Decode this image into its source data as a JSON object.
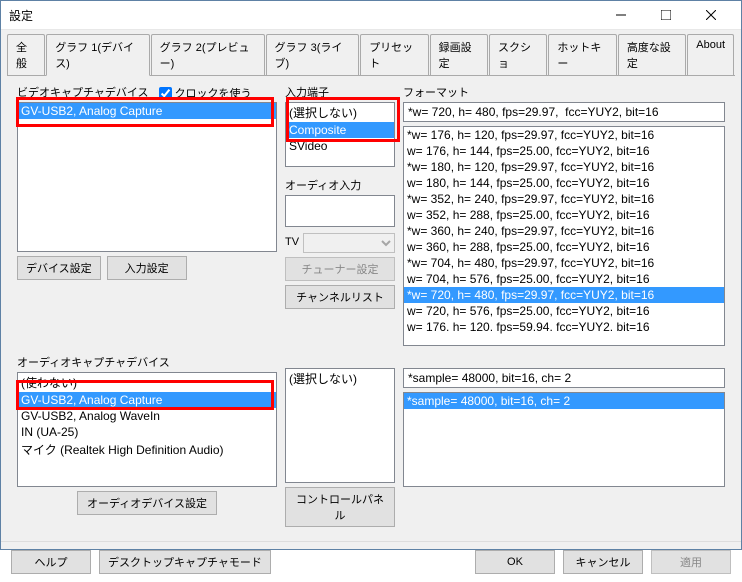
{
  "window_title": "設定",
  "tabs": [
    "全般",
    "グラフ 1(デバイス)",
    "グラフ 2(プレビュー)",
    "グラフ 3(ライブ)",
    "プリセット",
    "録画設定",
    "スクショ",
    "ホットキー",
    "高度な設定",
    "About"
  ],
  "active_tab": 1,
  "labels": {
    "video_device": "ビデオキャプチャデバイス",
    "use_clock": "クロックを使う",
    "device_settings": "デバイス設定",
    "input_settings": "入力設定",
    "audio_device": "オーディオキャプチャデバイス",
    "audio_device_settings": "オーディオデバイス設定",
    "input_terminal": "入力端子",
    "audio_input": "オーディオ入力",
    "tv": "TV",
    "tuner_settings": "チューナー設定",
    "channel_list": "チャンネルリスト",
    "control_panel": "コントロールパネル",
    "format": "フォーマット",
    "not_select": "(選択しない)",
    "help": "ヘルプ",
    "desktop_capture": "デスクトップキャプチャモード",
    "ok": "OK",
    "cancel": "キャンセル",
    "apply": "適用"
  },
  "video_devices": [
    "GV-USB2, Analog Capture"
  ],
  "video_device_selected": 0,
  "input_terminals": [
    "(選択しない)",
    "Composite",
    "SVideo"
  ],
  "input_terminal_selected": 1,
  "audio_devices": [
    "(使わない)",
    "GV-USB2, Analog Capture",
    "GV-USB2, Analog WaveIn",
    "IN (UA-25)",
    "マイク (Realtek High Definition Audio)"
  ],
  "audio_device_selected": 1,
  "format_current": "*w= 720, h= 480, fps=29.97,  fcc=YUY2, bit=16",
  "formats": [
    "*w= 176, h= 120, fps=29.97,  fcc=YUY2, bit=16",
    "w= 176, h= 144, fps=25.00,  fcc=YUY2, bit=16",
    "*w= 180, h= 120, fps=29.97,  fcc=YUY2, bit=16",
    "w= 180, h= 144, fps=25.00,  fcc=YUY2, bit=16",
    "*w= 352, h= 240, fps=29.97,  fcc=YUY2, bit=16",
    "w= 352, h= 288, fps=25.00,  fcc=YUY2, bit=16",
    "*w= 360, h= 240, fps=29.97,  fcc=YUY2, bit=16",
    "w= 360, h= 288, fps=25.00,  fcc=YUY2, bit=16",
    "*w= 704, h= 480, fps=29.97,  fcc=YUY2, bit=16",
    "w= 704, h= 576, fps=25.00,  fcc=YUY2, bit=16",
    "*w= 720, h= 480, fps=29.97,  fcc=YUY2, bit=16",
    "w= 720, h= 576, fps=25.00,  fcc=YUY2, bit=16",
    "w= 176. h= 120. fps=59.94.  fcc=YUY2. bit=16"
  ],
  "format_selected": 10,
  "audio_format_current": "*sample= 48000, bit=16, ch= 2",
  "audio_formats": [
    "*sample= 48000, bit=16, ch= 2"
  ],
  "audio_format_selected": 0,
  "use_clock_checked": true
}
